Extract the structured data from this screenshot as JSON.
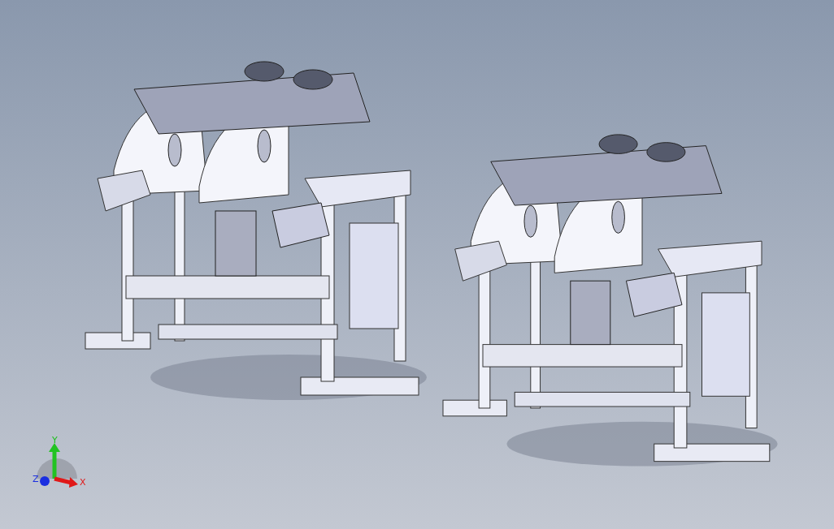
{
  "viewport": {
    "models": [
      {
        "kind": "machine"
      },
      {
        "kind": "machine"
      }
    ],
    "triad": {
      "x_label": "X",
      "y_label": "Y",
      "z_label": "Z"
    }
  }
}
